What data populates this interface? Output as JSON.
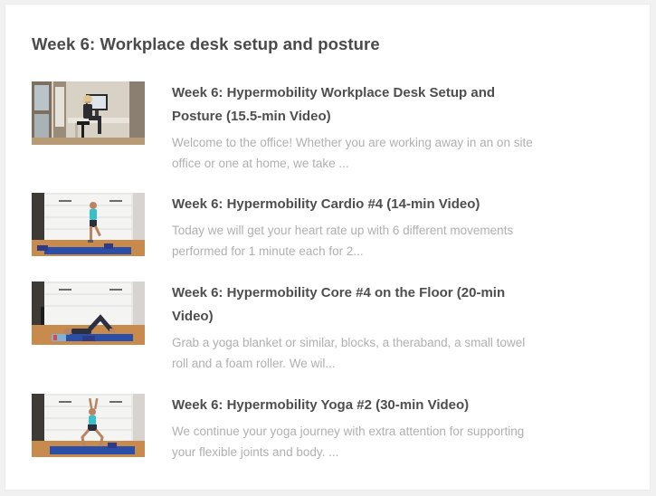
{
  "section": {
    "title": "Week 6: Workplace desk setup and posture"
  },
  "lessons": [
    {
      "title": "Week 6: Hypermobility Workplace Desk Setup and Posture (15.5-min Video)",
      "excerpt": "Welcome to the office! Whether you are working away in an on site office or one at home, we take ...",
      "thumbnail": "office-desk-thumbnail"
    },
    {
      "title": "Week 6: Hypermobility Cardio #4 (14-min Video)",
      "excerpt": "Today we will get your heart rate up with 6 different movements performed for 1 minute each for 2...",
      "thumbnail": "cardio-exercise-thumbnail"
    },
    {
      "title": "Week 6: Hypermobility Core #4 on the Floor (20-min Video)",
      "excerpt": "Grab a yoga blanket or similar, blocks, a theraband, a small towel roll and a foam roller. We wil...",
      "thumbnail": "floor-core-thumbnail"
    },
    {
      "title": "Week 6: Hypermobility Yoga #2 (30-min Video)",
      "excerpt": "We continue your yoga journey with extra attention for supporting your flexible joints and body. ...",
      "thumbnail": "yoga-thumbnail"
    }
  ],
  "colors": {
    "background": "#f1f1f1",
    "card": "#ffffff",
    "title_text": "#4a4a4a",
    "excerpt_text": "#b0b0b0",
    "mat_blue": "#2a4fa8",
    "floor_wood": "#c98a4e"
  }
}
